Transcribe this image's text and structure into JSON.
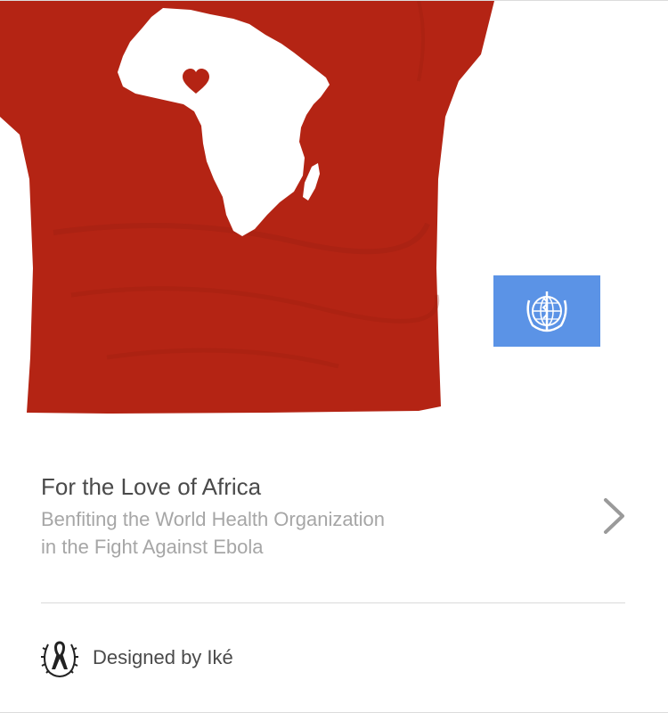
{
  "product": {
    "title": "For the Love of Africa",
    "subtitle_line1": "Benfiting the World Health Organization",
    "subtitle_line2": "in the Fight Against Ebola",
    "shirt_color": "#b42414",
    "print_color": "#ffffff",
    "heart_color": "#b42414",
    "image_icon": "tshirt-africa-heart-image"
  },
  "partner": {
    "name_icon": "who-emblem-icon",
    "flag_color": "#5b93e6"
  },
  "navigation": {
    "next_icon": "chevron-right-icon",
    "chevron_color": "#9a9a9a"
  },
  "designer": {
    "label": "Designed by Iké",
    "logo_icon": "awareness-ribbon-laurel-icon"
  }
}
